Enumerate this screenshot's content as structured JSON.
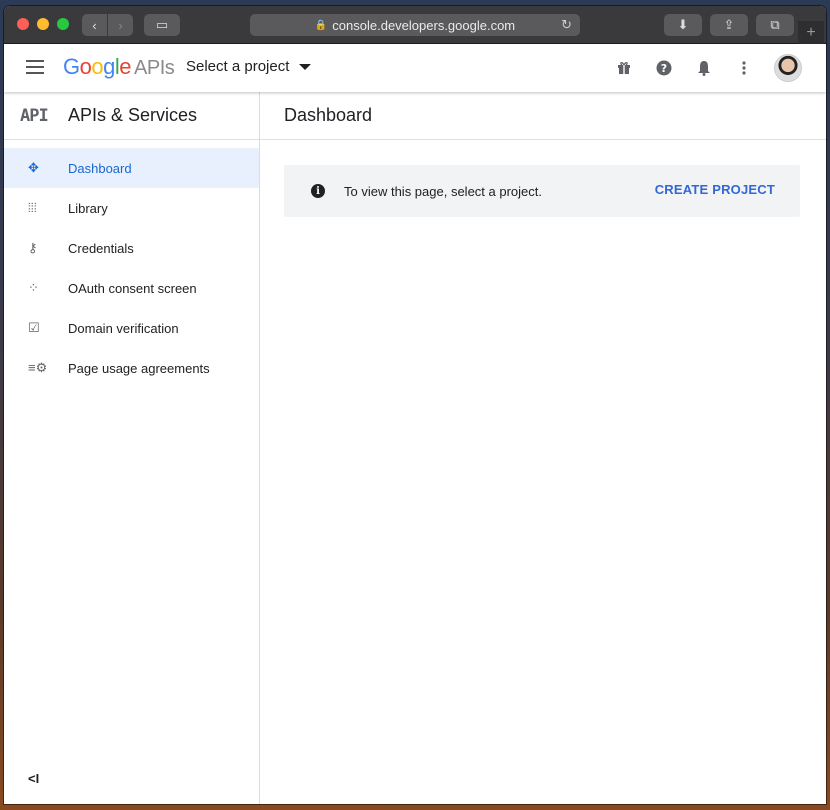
{
  "browser": {
    "url": "console.developers.google.com",
    "new_tab": "+"
  },
  "header": {
    "logo_letters": [
      "G",
      "o",
      "o",
      "g",
      "l",
      "e"
    ],
    "logo_suffix": "APIs",
    "project_selector": "Select a project",
    "icons": [
      "gift-icon",
      "help-icon",
      "notifications-icon",
      "more-vert-icon",
      "avatar"
    ]
  },
  "sidebar": {
    "logo": "API",
    "title": "APIs & Services",
    "items": [
      {
        "label": "Dashboard",
        "icon": "dashboard-icon",
        "active": true
      },
      {
        "label": "Library",
        "icon": "library-icon"
      },
      {
        "label": "Credentials",
        "icon": "key-icon"
      },
      {
        "label": "OAuth consent screen",
        "icon": "oauth-icon"
      },
      {
        "label": "Domain verification",
        "icon": "checkbox-icon"
      },
      {
        "label": "Page usage agreements",
        "icon": "settings-list-icon"
      }
    ],
    "collapse_label": "<I"
  },
  "main": {
    "title": "Dashboard",
    "notice": {
      "text": "To view this page, select a project.",
      "action": "CREATE PROJECT"
    }
  },
  "colors": {
    "accent": "#1967d2",
    "active_bg": "#e8f0fe"
  }
}
